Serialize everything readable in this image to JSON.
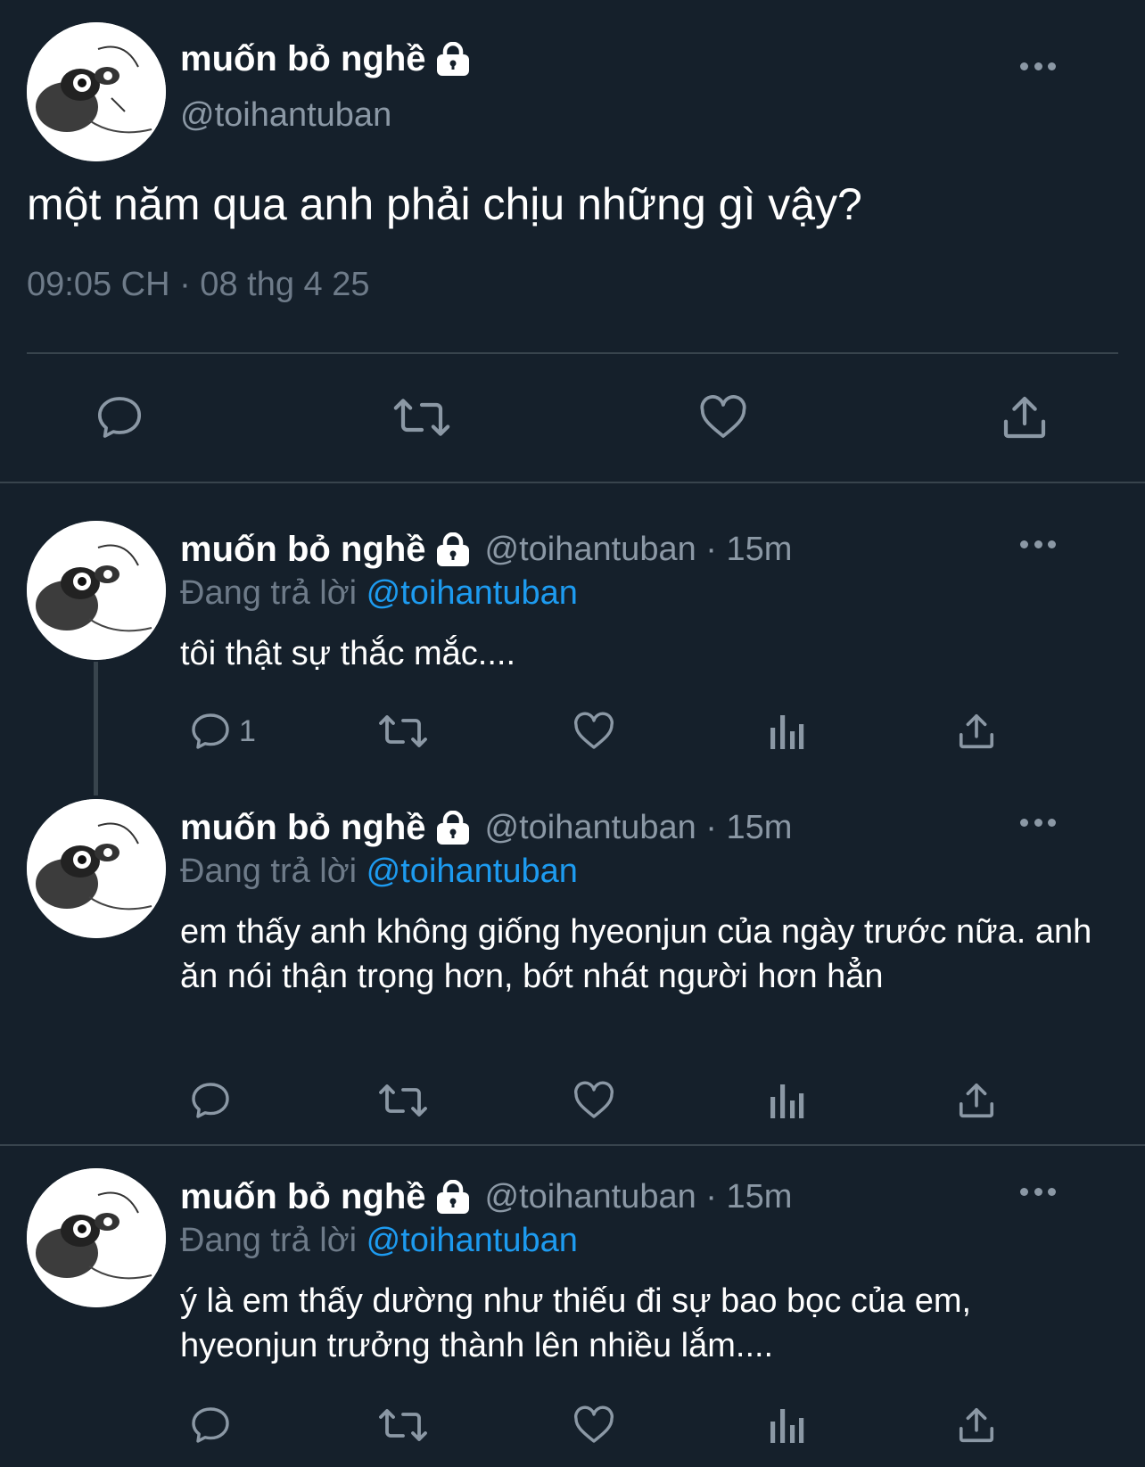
{
  "main_tweet": {
    "display_name": "muốn bỏ nghề",
    "handle": "@toihantuban",
    "text": "một năm qua anh phải chịu những gì vậy?",
    "timestamp": "09:05 CH · 08 thg 4 25",
    "actions": [
      "reply-icon",
      "retweet-icon",
      "like-icon",
      "share-icon"
    ]
  },
  "replies": [
    {
      "display_name": "muốn bỏ nghề",
      "handle_time": "@toihantuban · 15m",
      "replying_prefix": "Đang trả lời",
      "replying_to": "@toihantuban",
      "text": "tôi thật sự thắc mắc....",
      "reply_count": "1"
    },
    {
      "display_name": "muốn bỏ nghề",
      "handle_time": "@toihantuban · 15m",
      "replying_prefix": "Đang trả lời",
      "replying_to": "@toihantuban",
      "text": "em thấy anh không giống hyeonjun của ngày trước nữa. anh ăn nói thận trọng hơn, bớt nhát người hơn hẳn",
      "reply_count": ""
    },
    {
      "display_name": "muốn bỏ nghề",
      "handle_time": "@toihantuban · 15m",
      "replying_prefix": "Đang trả lời",
      "replying_to": "@toihantuban",
      "text": "ý là em thấy dường như thiếu đi sự bao bọc của em, hyeonjun trưởng thành lên nhiều lắm....",
      "reply_count": ""
    }
  ],
  "colors": {
    "background": "#15202b",
    "secondary_text": "#8b98a5",
    "mention": "#1d9bf0",
    "divider": "#38444d"
  }
}
